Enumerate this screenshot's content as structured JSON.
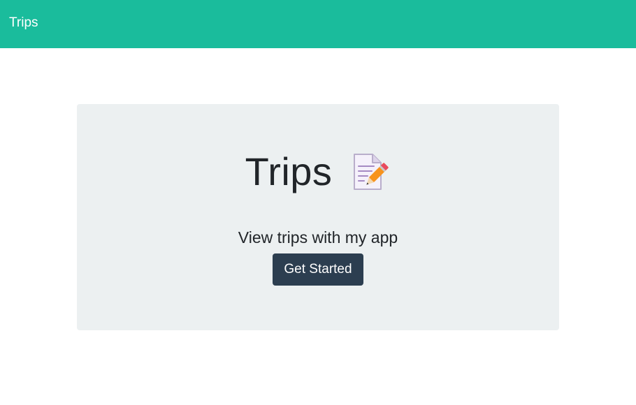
{
  "navbar": {
    "brand": "Trips",
    "background_color": "#1abc9c"
  },
  "hero": {
    "title": "Trips",
    "title_icon": "memo-icon",
    "subtitle": "View trips with my app",
    "button_label": "Get Started",
    "panel_color": "#ecf0f1",
    "button_color": "#2c3e50"
  }
}
